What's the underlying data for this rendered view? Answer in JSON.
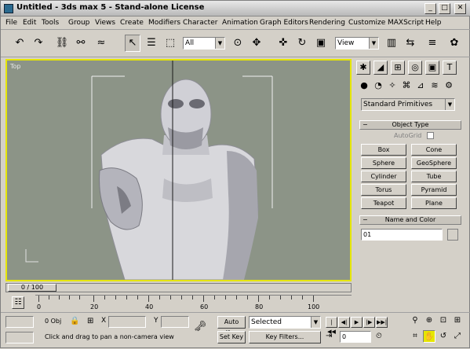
{
  "window": {
    "title": "Untitled - 3ds max 5 - Stand-alone License",
    "minimize": "_",
    "maximize": "□",
    "close": "✕"
  },
  "menu": [
    "File",
    "Edit",
    "Tools",
    "Group",
    "Views",
    "Create",
    "Modifiers",
    "Character",
    "Animation",
    "Graph Editors",
    "Rendering",
    "Customize",
    "MAXScript",
    "Help"
  ],
  "toolbar": {
    "selection_filter": "All",
    "reference_coord": "View"
  },
  "viewport": {
    "label": "Top",
    "background": "#8c9487",
    "border_color": "#e6e600"
  },
  "command_panel": {
    "category_dropdown": "Standard Primitives",
    "object_type_header": "Object Type",
    "autogrid_label": "AutoGrid",
    "buttons": [
      "Box",
      "Cone",
      "Sphere",
      "GeoSphere",
      "Cylinder",
      "Tube",
      "Torus",
      "Pyramid",
      "Teapot",
      "Plane"
    ],
    "name_color_header": "Name and Color",
    "name_value": "01"
  },
  "timeline": {
    "slider_label": "0 / 100",
    "ticks": [
      "0",
      "20",
      "40",
      "60",
      "80",
      "100"
    ]
  },
  "status": {
    "lock_label": "0 Obj",
    "x_label": "X",
    "y_label": "Y",
    "auto_key": "Auto Key",
    "set_key": "Set Key",
    "selected": "Selected",
    "key_filters": "Key Filters...",
    "frame": "0",
    "prompt": "Click and drag to pan a non-camera view"
  }
}
